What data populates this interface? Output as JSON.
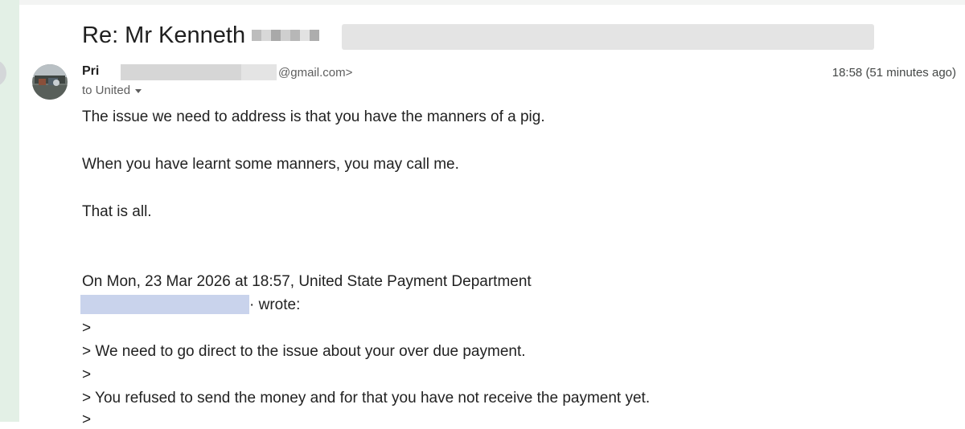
{
  "email": {
    "subject": "Re: Mr Kenneth",
    "sender": {
      "name_visible": "Pri",
      "email_suffix": "@gmail.com>",
      "timestamp": "18:58 (51 minutes ago)",
      "recipient": "to United"
    },
    "body": [
      "The issue we need to address is that you have the manners of a pig.",
      "When you have learnt some manners, you may call me.",
      "That is all."
    ],
    "quote_header": {
      "line1": "On Mon, 23 Mar 2026 at 18:57, United State Payment Department",
      "line2_suffix": "· wrote:"
    },
    "quoted_lines": [
      ">",
      "> We need to go direct to the issue about your over due payment.",
      ">",
      "> You refused to send the money and for that you have not receive the payment yet.",
      ">"
    ]
  },
  "icons": {
    "recipient_dropdown": "chevron-down-icon",
    "avatar": "sender-avatar-photo"
  },
  "colors": {
    "rail": "#e3f0e6",
    "redaction_gray": "#e4e4e4",
    "redaction_blue": "#c9d3ec"
  }
}
